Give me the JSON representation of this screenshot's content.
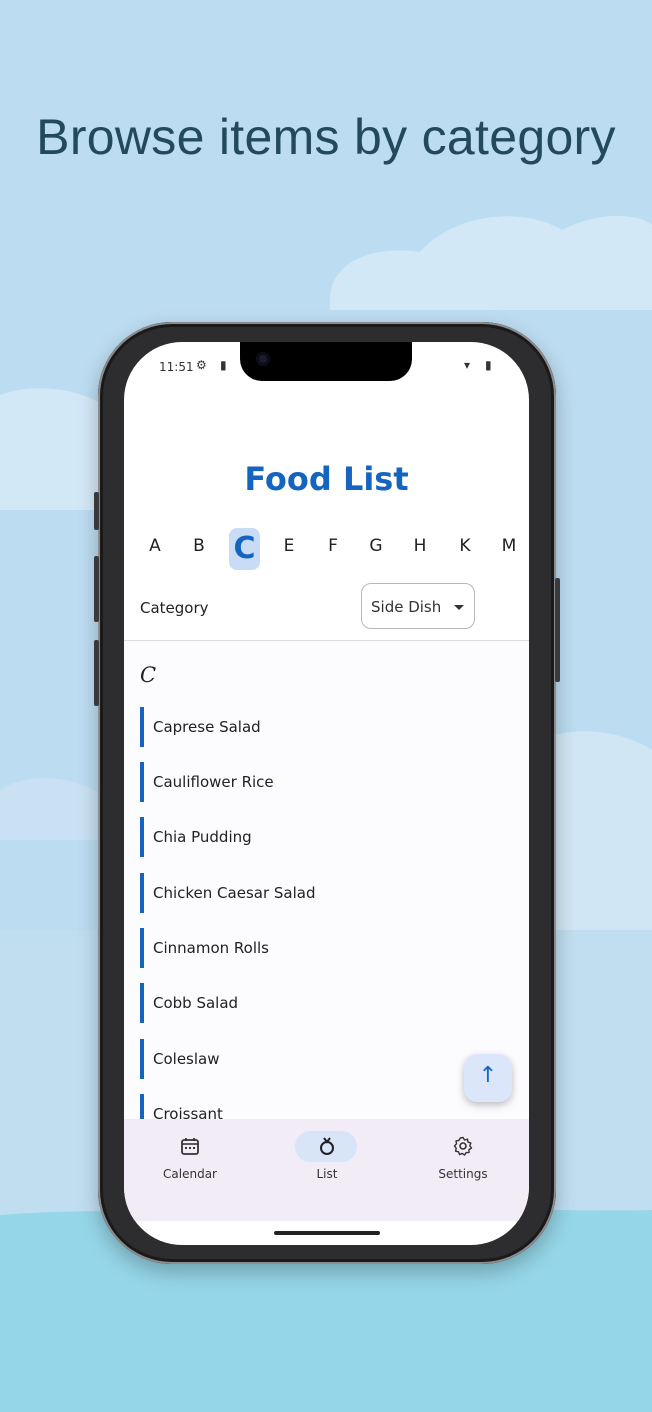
{
  "promo": {
    "headline": "Browse items by category"
  },
  "status_bar": {
    "time": "11:51"
  },
  "app": {
    "title": "Food List",
    "letters": [
      "A",
      "B",
      "C",
      "E",
      "F",
      "G",
      "H",
      "K",
      "M"
    ],
    "selected_letter": "C",
    "filter": {
      "label": "Category",
      "value": "Side Dish"
    },
    "section_header": "C",
    "items": [
      "Caprese Salad",
      "Cauliflower Rice",
      "Chia Pudding",
      "Chicken Caesar Salad",
      "Cinnamon Rolls",
      "Cobb Salad",
      "Coleslaw",
      "Croissant"
    ],
    "fab_icon": "arrow-up-icon",
    "nav": [
      {
        "label": "Calendar",
        "icon": "calendar-icon",
        "active": false
      },
      {
        "label": "List",
        "icon": "food-list-icon",
        "active": true
      },
      {
        "label": "Settings",
        "icon": "gear-icon",
        "active": false
      }
    ]
  },
  "colors": {
    "accent": "#1565c0",
    "selected_letter_bg": "#c9dcf7",
    "sky": "#bcdcf1",
    "nav_bg": "#f2ecf6"
  }
}
